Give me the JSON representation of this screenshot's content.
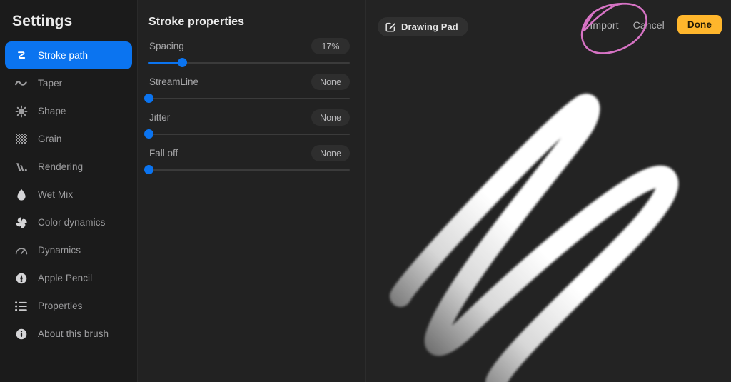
{
  "sidebar": {
    "title": "Settings",
    "items": [
      {
        "label": "Stroke path",
        "icon": "stroke-path-icon",
        "active": true
      },
      {
        "label": "Taper",
        "icon": "taper-wave-icon",
        "active": false
      },
      {
        "label": "Shape",
        "icon": "shape-starburst-icon",
        "active": false
      },
      {
        "label": "Grain",
        "icon": "grain-texture-icon",
        "active": false
      },
      {
        "label": "Rendering",
        "icon": "rendering-icon",
        "active": false
      },
      {
        "label": "Wet Mix",
        "icon": "water-drop-icon",
        "active": false
      },
      {
        "label": "Color dynamics",
        "icon": "color-dynamics-icon",
        "active": false
      },
      {
        "label": "Dynamics",
        "icon": "speedometer-icon",
        "active": false
      },
      {
        "label": "Apple Pencil",
        "icon": "apple-pencil-icon",
        "active": false
      },
      {
        "label": "Properties",
        "icon": "list-lines-icon",
        "active": false
      },
      {
        "label": "About this brush",
        "icon": "info-circle-icon",
        "active": false
      }
    ]
  },
  "properties_panel": {
    "title": "Stroke properties",
    "sliders": [
      {
        "label": "Spacing",
        "value": "17%",
        "percent": 17
      },
      {
        "label": "StreamLine",
        "value": "None",
        "percent": 0
      },
      {
        "label": "Jitter",
        "value": "None",
        "percent": 0
      },
      {
        "label": "Fall off",
        "value": "None",
        "percent": 0
      }
    ]
  },
  "canvas": {
    "drawing_pad": {
      "label": "Drawing Pad",
      "icon": "compose-square-pencil-icon"
    },
    "actions": {
      "import_label": "Import",
      "cancel_label": "Cancel",
      "done_label": "Done"
    },
    "brush_stroke": {
      "icon": "brush-stroke-preview",
      "color": "#ffffff"
    },
    "annotation": {
      "icon": "pink-circle-annotation",
      "color": "#d673c4",
      "targets": "Import"
    }
  },
  "colors": {
    "accent_blue": "#0b74f0",
    "done_amber": "#ffb62c",
    "annotation_pink": "#d673c4",
    "sidebar_bg": "#1b1b1b",
    "panel_bg": "#222222",
    "canvas_bg": "#232323"
  }
}
